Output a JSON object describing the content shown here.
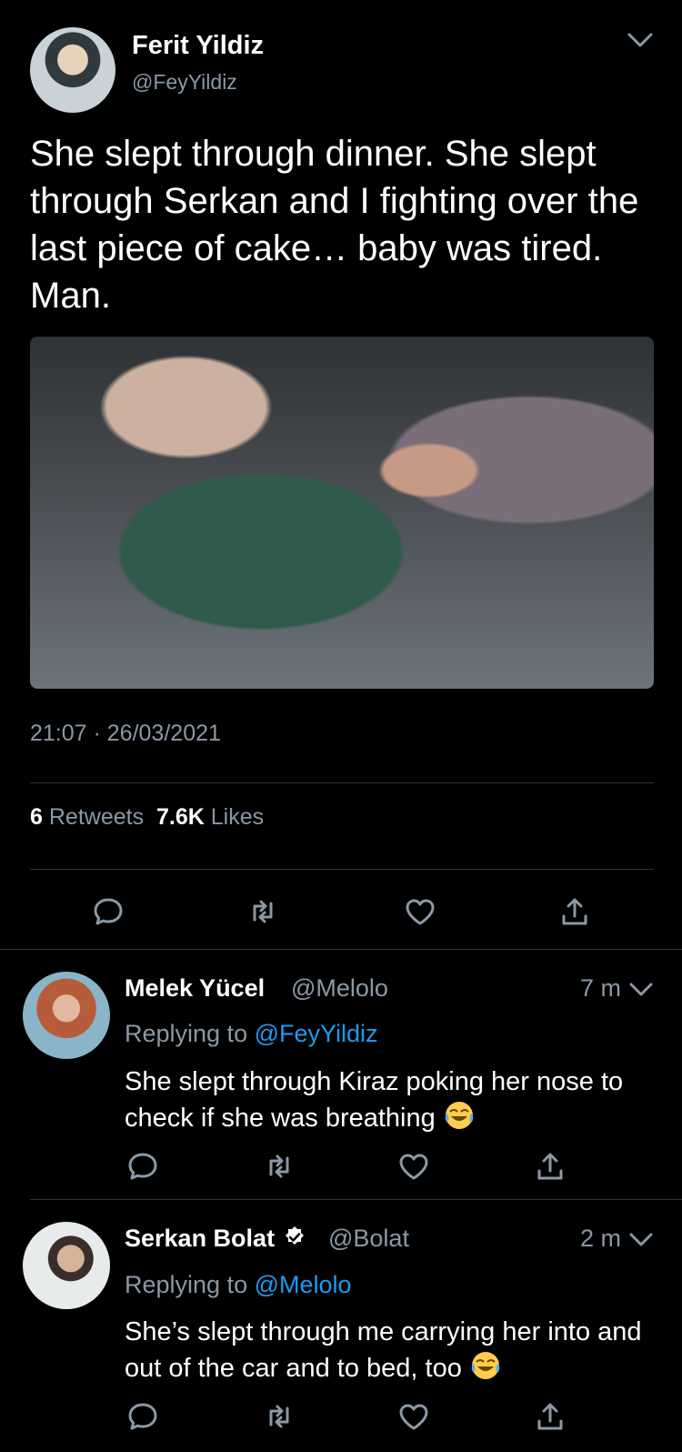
{
  "tweet": {
    "author_name": "Ferit Yildiz",
    "author_handle": "@FeyYildiz",
    "text": "She slept through dinner. She slept through Serkan and I fighting over the last piece of cake… baby was tired. Man.",
    "time": "21:07 · 26/03/2021",
    "retweets_count": "6",
    "retweets_label": "Retweets",
    "likes_count": "7.6K",
    "likes_label": "Likes"
  },
  "replies": [
    {
      "name": "Melek Yücel",
      "handle": "@Melolo",
      "time": "7 m",
      "replying_prefix": "Replying to",
      "replying_to": "@FeyYildiz",
      "text": "She slept through Kiraz poking her nose to check if she was breathing"
    },
    {
      "name": "Serkan Bolat",
      "handle": "@Bolat",
      "time": "2 m",
      "replying_prefix": "Replying to",
      "replying_to": "@Melolo",
      "text": "She’s slept through me carrying her into and out of the car and to bed, too"
    }
  ],
  "icons": {
    "reply": "reply-icon",
    "retweet": "retweet-icon",
    "like": "heart-icon",
    "share": "share-icon",
    "more": "chevron-down-icon",
    "emoji": "tears-of-joy-emoji",
    "verified": "verified-badge-icon"
  },
  "colors": {
    "background": "#000000",
    "accent": "#1d9bf0",
    "secondary_text": "#8b98a5",
    "divider": "#2f3336"
  }
}
